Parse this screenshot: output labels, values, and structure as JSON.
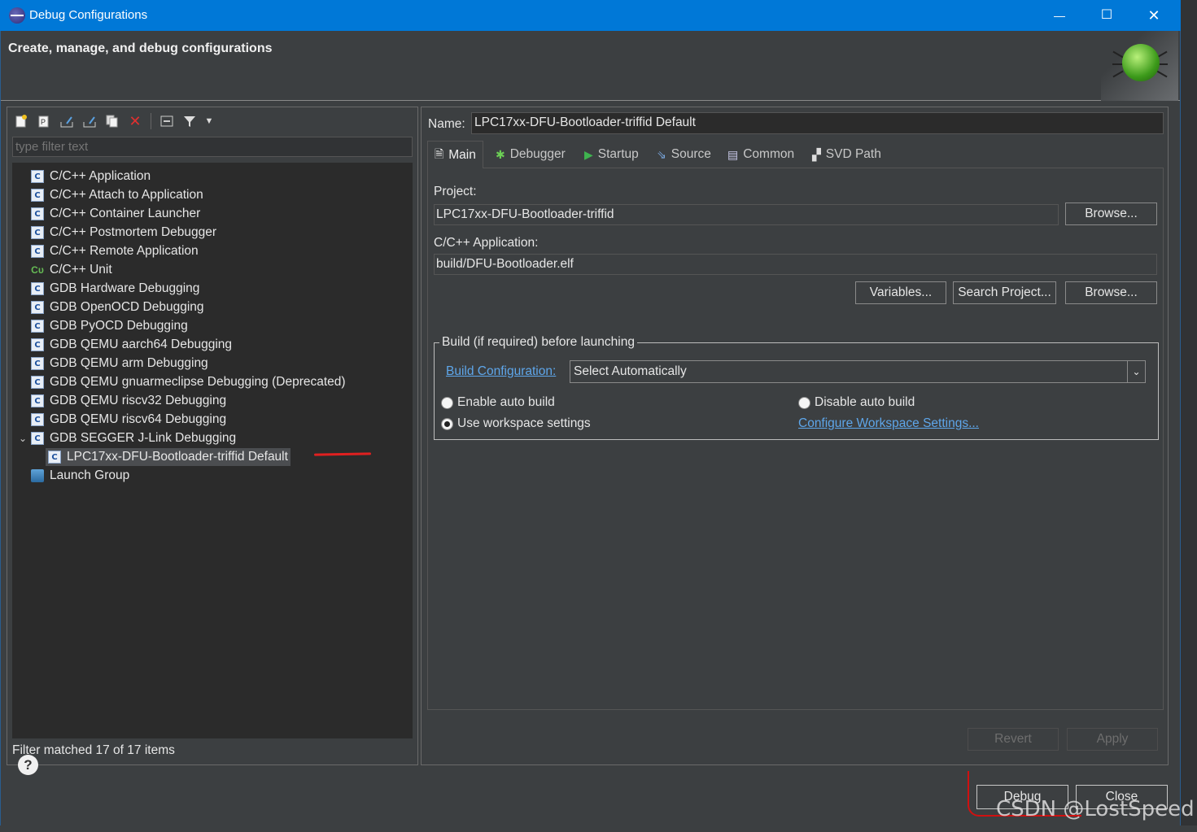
{
  "window": {
    "title": "Debug Configurations",
    "minimize": "—",
    "maximize": "☐",
    "close": "✕"
  },
  "banner": {
    "heading": "Create, manage, and debug configurations"
  },
  "left": {
    "filter_placeholder": "type filter text",
    "tree": [
      {
        "label": "C/C++ Application",
        "icon": "c-config-icon"
      },
      {
        "label": "C/C++ Attach to Application",
        "icon": "c-config-icon"
      },
      {
        "label": "C/C++ Container Launcher",
        "icon": "c-config-icon"
      },
      {
        "label": "C/C++ Postmortem Debugger",
        "icon": "c-config-icon"
      },
      {
        "label": "C/C++ Remote Application",
        "icon": "c-config-icon"
      },
      {
        "label": "C/C++ Unit",
        "icon": "c-unit-icon"
      },
      {
        "label": "GDB Hardware Debugging",
        "icon": "c-config-icon"
      },
      {
        "label": "GDB OpenOCD Debugging",
        "icon": "c-config-icon"
      },
      {
        "label": "GDB PyOCD Debugging",
        "icon": "c-config-icon"
      },
      {
        "label": "GDB QEMU aarch64 Debugging",
        "icon": "c-config-icon"
      },
      {
        "label": "GDB QEMU arm Debugging",
        "icon": "c-config-icon"
      },
      {
        "label": "GDB QEMU gnuarmeclipse Debugging (Deprecated)",
        "icon": "c-config-icon"
      },
      {
        "label": "GDB QEMU riscv32 Debugging",
        "icon": "c-config-icon"
      },
      {
        "label": "GDB QEMU riscv64 Debugging",
        "icon": "c-config-icon"
      },
      {
        "label": "GDB SEGGER J-Link Debugging",
        "icon": "c-config-icon",
        "expanded": true
      },
      {
        "label": "LPC17xx-DFU-Bootloader-triffid Default",
        "icon": "c-config-icon",
        "selected": true
      },
      {
        "label": "Launch Group",
        "icon": "launch-group-icon"
      }
    ],
    "status": "Filter matched 17 of 17 items"
  },
  "right": {
    "name_label": "Name:",
    "name_value": "LPC17xx-DFU-Bootloader-triffid Default",
    "tabs": [
      {
        "label": "Main",
        "icon": "page-icon"
      },
      {
        "label": "Debugger",
        "icon": "bug-icon"
      },
      {
        "label": "Startup",
        "icon": "play-icon"
      },
      {
        "label": "Source",
        "icon": "source-icon"
      },
      {
        "label": "Common",
        "icon": "common-icon"
      },
      {
        "label": "SVD Path",
        "icon": "svd-icon"
      }
    ],
    "project_label": "Project:",
    "project_value": "LPC17xx-DFU-Bootloader-triffid",
    "browse1": "Browse...",
    "app_label": "C/C++ Application:",
    "app_value": "build/DFU-Bootloader.elf",
    "variables": "Variables...",
    "search_project": "Search Project...",
    "browse2": "Browse...",
    "build_group": "Build (if required) before launching",
    "build_config_link": "Build Configuration:",
    "build_config_value": "Select Automatically",
    "enable_auto": "Enable auto build",
    "disable_auto": "Disable auto build",
    "use_workspace": "Use workspace settings",
    "configure_link": "Configure Workspace Settings...",
    "revert": "Revert",
    "apply": "Apply"
  },
  "footer": {
    "help": "?",
    "debug": "Debug",
    "close": "Close"
  },
  "watermark": "CSDN @LostSpeed"
}
